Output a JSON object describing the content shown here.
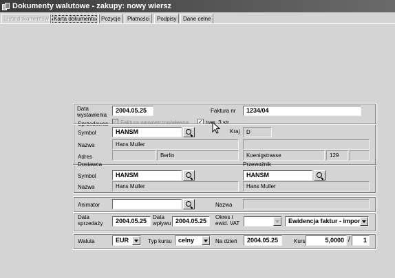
{
  "window": {
    "title": "Dokumenty walutowe - zakupy: nowy wiersz"
  },
  "tabs": [
    {
      "label": "Lista dokumentów",
      "state": "disabled"
    },
    {
      "label": "Karta dokumentu",
      "state": "active"
    },
    {
      "label": "Pozycje",
      "state": "normal"
    },
    {
      "label": "Płatności",
      "state": "normal"
    },
    {
      "label": "Podpisy",
      "state": "normal"
    },
    {
      "label": "Dane celne",
      "state": "normal"
    }
  ],
  "form": {
    "data_wystawienia_label": "Data\nwystawienia",
    "data_wystawienia": "2004.05.25",
    "faktura_nr_label": "Faktura nr",
    "faktura_nr": "1234/04",
    "sprzedawca_label": "Sprzedawca",
    "wewnetrzny_label": "Faktura wewnętrzna/własna",
    "tran3_label": "tran. 3 str.",
    "tran3_checked": "✓",
    "seller": {
      "symbol_label": "Symbol",
      "symbol": "HANSM",
      "kraj_label": "Kraj",
      "kraj": "D",
      "nazwa_label": "Nazwa",
      "nazwa": "Hans Muller",
      "adres_label": "Adres",
      "miasto": "Berlin",
      "ulica": "Koenigstrasse",
      "nr": "129"
    },
    "dostawca_label": "Dostawca",
    "przewoznik_label": "Przewoźnik",
    "supplier": {
      "symbol_label": "Symbol",
      "symbol": "HANSM",
      "nazwa_label": "Nazwa",
      "nazwa": "Hans Muller"
    },
    "carrier": {
      "symbol": "HANSM",
      "nazwa": "Hans Muller"
    },
    "animator_label": "Animator",
    "animator_nazwa_label": "Nazwa",
    "data_sprzedazy_label": "Data\nsprzedaży",
    "data_sprzedazy": "2004.05.25",
    "data_wplywu_label": "Data\nwpływu",
    "data_wplywu": "2004.05.25",
    "okres_vat_label": "Okres i\newid. VAT",
    "ewidencja": "Ewidencja faktur - import",
    "waluta_label": "Waluta",
    "waluta": "EUR",
    "typ_kursu_label": "Typ kursu",
    "typ_kursu": "celny",
    "na_dzien_label": "Na dzień",
    "na_dzien": "2004.05.25",
    "kurs_label": "Kurs",
    "kurs": "5,0000",
    "kurs_div": "1"
  }
}
